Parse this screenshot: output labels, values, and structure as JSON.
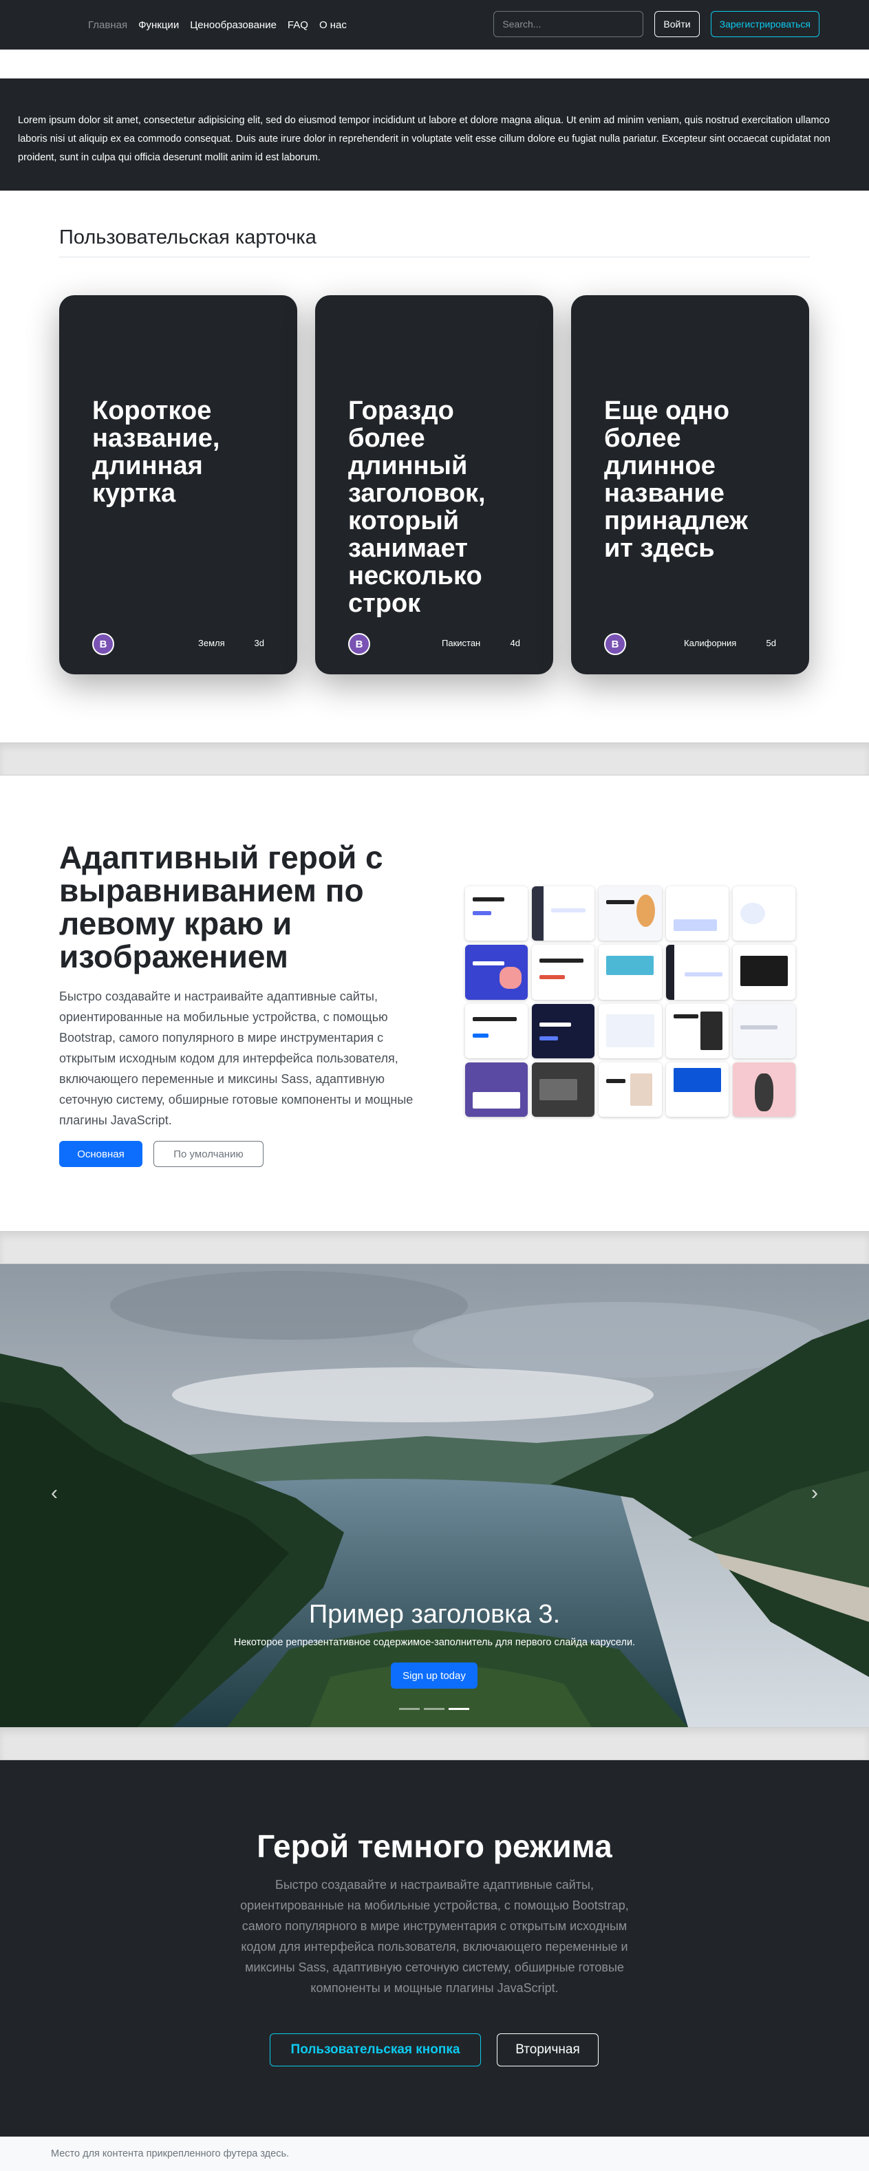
{
  "navbar": {
    "links": [
      "Главная",
      "Функции",
      "Ценообразование",
      "FAQ",
      "О нас"
    ],
    "search_placeholder": "Search...",
    "login_label": "Войти",
    "signup_label": "Зарегистрироваться"
  },
  "intro": {
    "text": "Lorem ipsum dolor sit amet, consectetur adipisicing elit, sed do eiusmod tempor incididunt ut labore et dolore magna aliqua. Ut enim ad minim veniam, quis nostrud exercitation ullamco laboris nisi ut aliquip ex ea commodo consequat. Duis aute irure dolor in reprehenderit in voluptate velit esse cillum dolore eu fugiat nulla pariatur. Excepteur sint occaecat cupidatat non proident, sunt in culpa qui officia deserunt mollit anim id est laborum."
  },
  "cards_section": {
    "title": "Пользовательская карточка",
    "cards": [
      {
        "title": "Короткое название, длинная куртка",
        "logo": "B",
        "place": "Земля",
        "days": "3d"
      },
      {
        "title": "Гораздо более длинный заголовок, который занимает несколько строк",
        "logo": "B",
        "place": "Пакистан",
        "days": "4d"
      },
      {
        "title": "Еще одно более длинное название принадлеж ит здесь",
        "logo": "B",
        "place": "Калифорния",
        "days": "5d"
      }
    ]
  },
  "hero": {
    "title": "Адаптивный герой с выравниванием по левому краю и изображением",
    "text": "Быстро создавайте и настраивайте адаптивные сайты, ориентированные на мобильные устройства, с помощью Bootstrap, самого популярного в мире инструментария с открытым исходным кодом для интерфейса пользователя, включающего переменные и миксины Sass, адаптивную сеточную систему, обширные готовые компоненты и мощные плагины JavaScript.",
    "primary_label": "Основная",
    "default_label": "По умолчанию"
  },
  "carousel": {
    "title": "Пример заголовка 3.",
    "subtitle": "Некоторое репрезентативное содержимое-заполнитель для первого слайда карусели.",
    "button_label": "Sign up today",
    "prev_icon": "‹",
    "next_icon": "›"
  },
  "dark_hero": {
    "title": "Герой темного режима",
    "text": "Быстро создавайте и настраивайте адаптивные сайты, ориентированные на мобильные устройства, с помощью Bootstrap, самого популярного в мире инструментария с открытым исходным кодом для интерфейса пользователя, включающего переменные и миксины Sass, адаптивную сеточную систему, обширные готовые компоненты и мощные плагины JavaScript.",
    "custom_label": "Пользовательская кнопка",
    "secondary_label": "Вторичная"
  },
  "footer": {
    "text": "Место для контента прикрепленного футера здесь."
  },
  "colors": {
    "dark": "#212529",
    "primary": "#0d6efd",
    "info": "#0dcaf0",
    "bootstrap_purple": "#7952b3"
  }
}
